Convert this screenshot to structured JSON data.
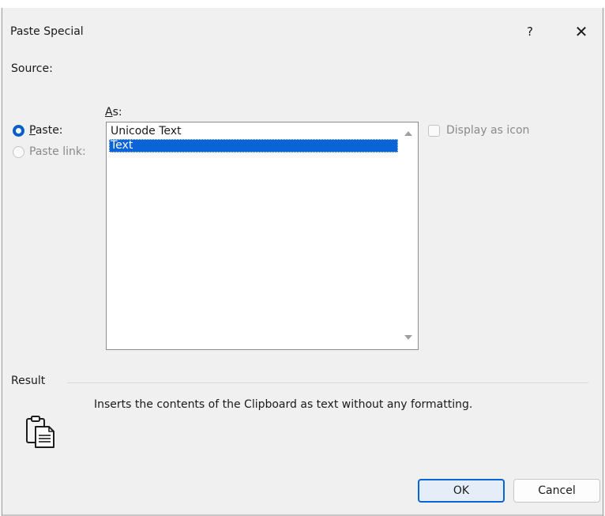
{
  "window": {
    "title": "Paste Special",
    "help_glyph": "?",
    "close_glyph": "✕"
  },
  "source": {
    "label": "Source:"
  },
  "as_label": {
    "accel": "A",
    "rest": "s:"
  },
  "radios": [
    {
      "accel": "P",
      "rest": "aste:",
      "selected": true,
      "enabled": true
    },
    {
      "label": "Paste link:",
      "selected": false,
      "enabled": false
    }
  ],
  "as_list": {
    "items": [
      "Unicode Text",
      "Text"
    ],
    "selected_index": 1
  },
  "display_as_icon": {
    "label": "Display as icon",
    "checked": false,
    "enabled": false
  },
  "result": {
    "label": "Result",
    "description": "Inserts the contents of the Clipboard as text without any formatting.",
    "icon": "clipboard-paste-icon"
  },
  "buttons": {
    "ok": "OK",
    "cancel": "Cancel"
  },
  "colors": {
    "accent": "#0a64d8",
    "background": "#f0f0f0",
    "disabled_text": "#8a8a8a"
  }
}
